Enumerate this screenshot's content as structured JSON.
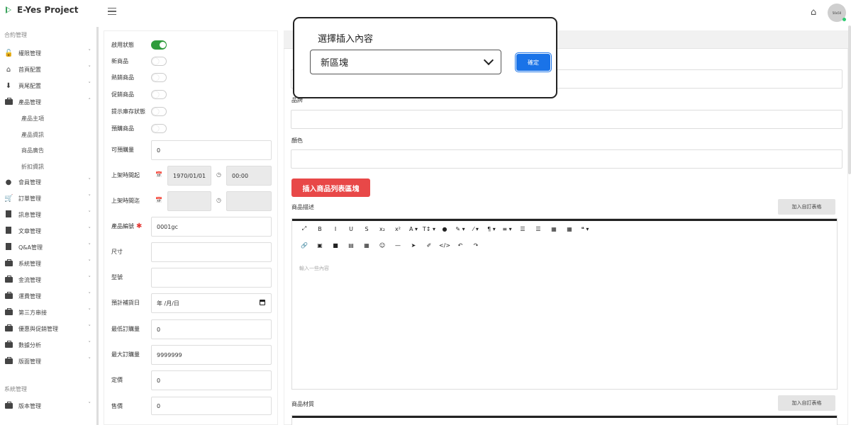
{
  "app": {
    "title": "E-Yes Project",
    "avatar_text": "50x50"
  },
  "sidebar": {
    "section1": "合約管理",
    "section2": "系統管理",
    "items": [
      {
        "label": "權限管理",
        "icon": "unlock-icon"
      },
      {
        "label": "首頁配置",
        "icon": "home-icon"
      },
      {
        "label": "頁尾配置",
        "icon": "download-icon"
      },
      {
        "label": "產品管理",
        "icon": "briefcase-icon"
      },
      {
        "label": "會員管理",
        "icon": "user-icon"
      },
      {
        "label": "訂單管理",
        "icon": "cart-icon"
      },
      {
        "label": "訊息管理",
        "icon": "file-icon"
      },
      {
        "label": "文章管理",
        "icon": "file-icon"
      },
      {
        "label": "Q&A管理",
        "icon": "file-icon"
      },
      {
        "label": "系統管理",
        "icon": "briefcase-icon"
      },
      {
        "label": "金流管理",
        "icon": "briefcase-icon"
      },
      {
        "label": "運費管理",
        "icon": "briefcase-icon"
      },
      {
        "label": "第三方串接",
        "icon": "briefcase-icon"
      },
      {
        "label": "優惠與促銷管理",
        "icon": "briefcase-icon"
      },
      {
        "label": "數據分析",
        "icon": "briefcase-icon"
      },
      {
        "label": "版面管理",
        "icon": "briefcase-icon"
      },
      {
        "label": "版本管理",
        "icon": "briefcase-icon"
      }
    ],
    "sub_items": [
      "產品主項",
      "產品資訊",
      "商品廣告",
      "折扣資訊"
    ]
  },
  "form": {
    "toggles": [
      {
        "label": "啟用狀態",
        "on": true
      },
      {
        "label": "新商品",
        "on": false
      },
      {
        "label": "熱銷商品",
        "on": false
      },
      {
        "label": "促銷商品",
        "on": false
      },
      {
        "label": "提示庫存狀態",
        "on": false
      },
      {
        "label": "預購商品",
        "on": false
      }
    ],
    "preorder_qty_label": "可預購量",
    "preorder_qty": "0",
    "launch_start_label": "上架時間起",
    "launch_start_date": "1970/01/01",
    "launch_start_time": "00:00",
    "launch_end_label": "上架時間迄",
    "sku_label": "產品編號",
    "sku_required": "✱",
    "sku": "0001gc",
    "size_label": "尺寸",
    "model_label": "型號",
    "restock_label": "預計補貨日",
    "restock_placeholder": "年 /月/日",
    "min_order_label": "最低訂購量",
    "min_order": "0",
    "max_order_label": "最大訂購量",
    "max_order": "9999999",
    "list_price_label": "定價",
    "list_price": "0",
    "sale_price_label": "售價",
    "sale_price": "0"
  },
  "main": {
    "brand_label": "品牌",
    "color_label": "顏色",
    "insert_block_button": "插入商品列表區塊",
    "desc_label": "商品描述",
    "add_table_button": "加入自訂表格",
    "editor_placeholder": "輸入一些內容",
    "spec_label": "商品材質",
    "add_table_button2": "加入自訂表格",
    "toolbar_row1": [
      "⤢",
      "B",
      "I",
      "U",
      "S",
      "x₂",
      "x²",
      "A ▾",
      "T↕ ▾",
      "●",
      "✎ ▾",
      "⁄ ▾",
      "¶ ▾",
      "≡ ▾",
      "☰",
      "☰",
      "▦",
      "▦",
      "❝ ▾"
    ],
    "toolbar_row2": [
      "🔗",
      "▣",
      "■",
      "▤",
      "▦",
      "☺",
      "—",
      "➤",
      "✐",
      "</>",
      "↶",
      "↷"
    ]
  },
  "modal": {
    "title": "選擇插入內容",
    "selected": "新區塊",
    "confirm": "確定"
  }
}
